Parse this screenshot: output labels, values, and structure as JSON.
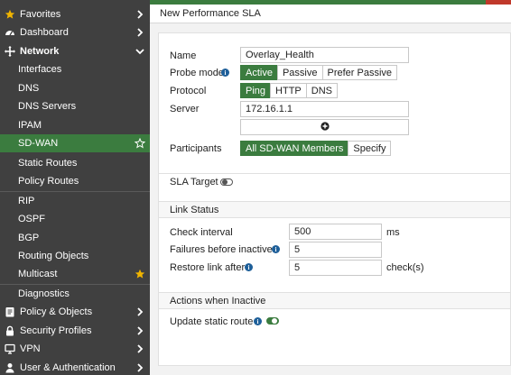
{
  "sidebar": {
    "items": [
      {
        "label": "Favorites",
        "icon": "star-icon",
        "expanded": false
      },
      {
        "label": "Dashboard",
        "icon": "dashboard-icon",
        "expanded": false
      },
      {
        "label": "Network",
        "icon": "network-icon",
        "expanded": true
      },
      {
        "label": "Interfaces"
      },
      {
        "label": "DNS"
      },
      {
        "label": "DNS Servers"
      },
      {
        "label": "IPAM"
      },
      {
        "label": "SD-WAN",
        "active": true,
        "favorite": false
      },
      {
        "label": "Static Routes"
      },
      {
        "label": "Policy Routes"
      },
      {
        "label": "RIP"
      },
      {
        "label": "OSPF"
      },
      {
        "label": "BGP"
      },
      {
        "label": "Routing Objects"
      },
      {
        "label": "Multicast",
        "favorite": true
      },
      {
        "label": "Diagnostics"
      },
      {
        "label": "Policy & Objects",
        "icon": "policy-icon",
        "expanded": false
      },
      {
        "label": "Security Profiles",
        "icon": "lock-icon",
        "expanded": false
      },
      {
        "label": "VPN",
        "icon": "monitor-icon",
        "expanded": false
      },
      {
        "label": "User & Authentication",
        "icon": "user-icon",
        "expanded": false
      }
    ]
  },
  "page": {
    "title": "New Performance SLA"
  },
  "form": {
    "name_label": "Name",
    "name_value": "Overlay_Health",
    "probe_mode_label": "Probe mode",
    "probe_modes": [
      "Active",
      "Passive",
      "Prefer Passive"
    ],
    "probe_mode_selected": "Active",
    "protocol_label": "Protocol",
    "protocols": [
      "Ping",
      "HTTP",
      "DNS"
    ],
    "protocol_selected": "Ping",
    "server_label": "Server",
    "server_value": "172.16.1.1",
    "participants_label": "Participants",
    "participants_options": [
      "All SD-WAN Members",
      "Specify"
    ],
    "participants_selected": "All SD-WAN Members",
    "sla_target_label": "SLA Target",
    "sla_target_on": false
  },
  "link_status": {
    "header": "Link Status",
    "check_interval_label": "Check interval",
    "check_interval_value": "500",
    "check_interval_unit": "ms",
    "failures_label": "Failures before inactive",
    "failures_value": "5",
    "restore_label": "Restore link after",
    "restore_value": "5",
    "restore_unit": "check(s)"
  },
  "actions": {
    "header": "Actions when Inactive",
    "update_static_route_label": "Update static route",
    "update_static_route_on": true
  },
  "colors": {
    "accent_green": "#3b7c3f",
    "sidebar_bg": "#404040",
    "favorite_star": "#f0b400",
    "info_blue": "#1e5f99"
  }
}
